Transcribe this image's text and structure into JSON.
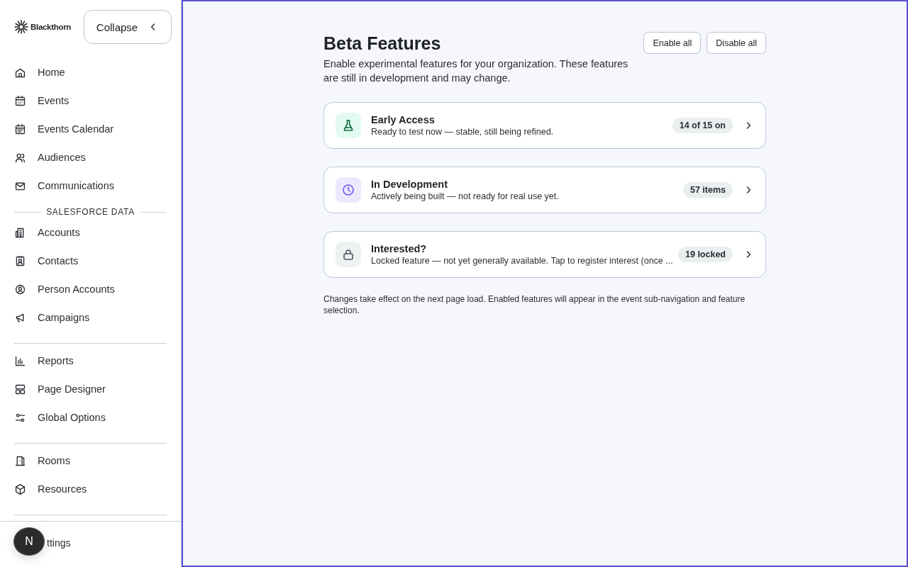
{
  "sidebar": {
    "logo": "Blackthorn",
    "collapse_button": "Collapse",
    "groups": [
      {
        "items": [
          {
            "label": "Home"
          },
          {
            "label": "Events"
          },
          {
            "label": "Events Calendar"
          },
          {
            "label": "Audiences"
          },
          {
            "label": "Communications"
          }
        ]
      },
      {
        "heading": "SALESFORCE DATA",
        "items": [
          {
            "label": "Accounts"
          },
          {
            "label": "Contacts"
          },
          {
            "label": "Person Accounts"
          },
          {
            "label": "Campaigns"
          }
        ]
      },
      {
        "items": [
          {
            "label": "Reports"
          },
          {
            "label": "Page Designer"
          },
          {
            "label": "Global Options"
          }
        ]
      },
      {
        "items": [
          {
            "label": "Rooms"
          },
          {
            "label": "Resources"
          }
        ]
      }
    ],
    "footer_item": "ttings",
    "avatar": "N"
  },
  "page": {
    "title": "Beta Features",
    "description": "Enable experimental features for your organization. These features are still in development and may change.",
    "buttons": [
      "Enable all",
      "Disable all"
    ],
    "cards": [
      {
        "title": "Early Access",
        "subtitle": "Ready to test now — stable, still being refined.",
        "badge": "14 of 15 on"
      },
      {
        "title": "In Development",
        "subtitle": "Actively being built — not ready for real use yet.",
        "badge": "57 items"
      },
      {
        "title": "Interested?",
        "subtitle": "Locked feature — not yet generally available. Tap to register interest (once ...",
        "badge": "19 locked"
      }
    ],
    "footnote": "Changes take effect on the next page load. Enabled features will appear in the event sub-navigation and feature selection."
  }
}
